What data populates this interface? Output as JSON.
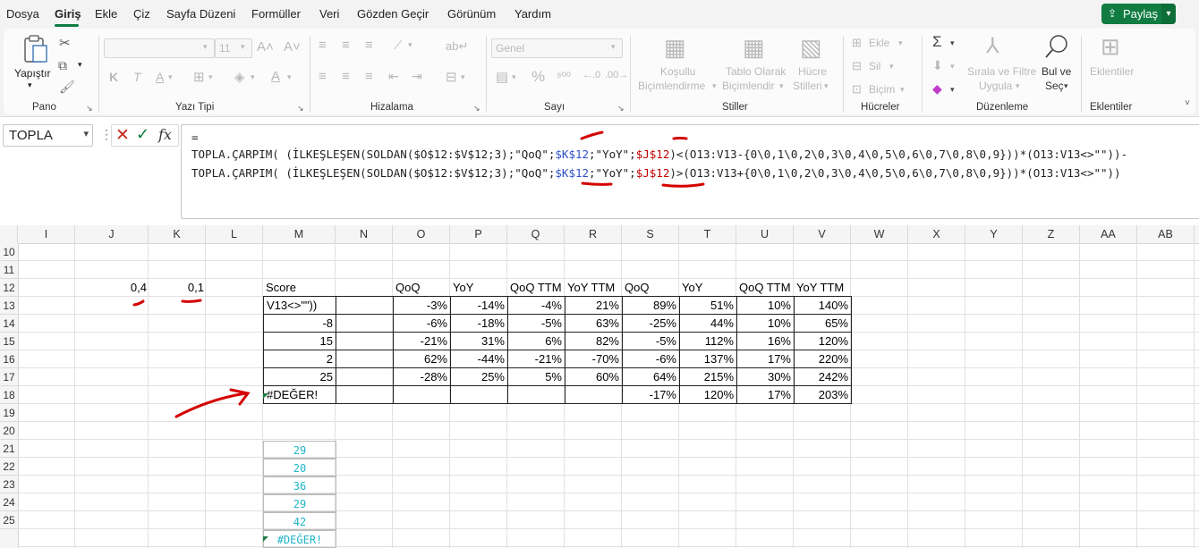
{
  "menu": {
    "items": [
      "Dosya",
      "Giriş",
      "Ekle",
      "Çiz",
      "Sayfa Düzeni",
      "Formüller",
      "Veri",
      "Gözden Geçir",
      "Görünüm",
      "Yardım"
    ],
    "active": "Giriş",
    "share_label": "Paylaş"
  },
  "ribbon": {
    "paste_label": "Yapıştır",
    "font_name": "",
    "font_size": "11",
    "number_format": "Genel",
    "conditional_label_1": "Koşullu",
    "conditional_label_2": "Biçimlendirme",
    "table_label_1": "Tablo Olarak",
    "table_label_2": "Biçimlendir",
    "cellstyles_label_1": "Hücre",
    "cellstyles_label_2": "Stilleri",
    "insert_label": "Ekle",
    "delete_label": "Sil",
    "format_label": "Biçim",
    "sort_label_1": "Sırala ve Filtre",
    "sort_label_2": "Uygula",
    "find_label_1": "Bul ve",
    "find_label_2": "Seç",
    "addins_label": "Eklentiler",
    "groups": {
      "clipboard": "Pano",
      "font": "Yazı Tipi",
      "alignment": "Hizalama",
      "number": "Sayı",
      "styles": "Stiller",
      "cells": "Hücreler",
      "editing": "Düzenleme",
      "addins": "Eklentiler"
    }
  },
  "formula_bar": {
    "name_box": "TOPLA",
    "fx_label": "fx",
    "line1": "=",
    "line2_a": "TOPLA.ÇARPIM( (İLKEŞLEŞEN(SOLDAN($O$12:$V$12;3);\"QoQ\";",
    "line2_b": "$K$12",
    "line2_c": ";\"YoY\";",
    "line2_d": "$J$12",
    "line2_e": ")<(O13:V13-{0\\0,1\\0,2\\0,3\\0,4\\0,5\\0,6\\0,7\\0,8\\0,9}))*(O13:V13<>\"\"))-",
    "line3_a": "TOPLA.ÇARPIM( (İLKEŞLEŞEN(SOLDAN($O$12:$V$12;3);\"QoQ\";",
    "line3_b": "$K$12",
    "line3_c": ";\"YoY\";",
    "line3_d": "$J$12",
    "line3_e": ")>(O13:V13+{0\\0,1\\0,2\\0,3\\0,4\\0,5\\0,6\\0,7\\0,8\\0,9}))*(O13:V13<>\"\"))"
  },
  "columns": [
    "I",
    "J",
    "K",
    "L",
    "M",
    "N",
    "O",
    "P",
    "Q",
    "R",
    "S",
    "T",
    "U",
    "V",
    "W",
    "X",
    "Y",
    "Z",
    "AA",
    "AB"
  ],
  "rows": [
    "10",
    "11",
    "12",
    "13",
    "14",
    "15",
    "16",
    "17",
    "18",
    "19",
    "20",
    "21",
    "22",
    "23",
    "24",
    "25"
  ],
  "sheet": {
    "j12": "0,4",
    "k12": "0,1",
    "m12": "Score",
    "headers": [
      "QoQ",
      "YoY",
      "QoQ TTM",
      "YoY TTM",
      "QoQ",
      "YoY",
      "QoQ TTM",
      "YoY TTM"
    ],
    "m_values": [
      "V13<>\"\"))",
      "-8",
      "15",
      "2",
      "25",
      "#DEĞER!"
    ],
    "table": [
      [
        "-3%",
        "-14%",
        "-4%",
        "21%",
        "89%",
        "51%",
        "10%",
        "140%"
      ],
      [
        "-6%",
        "-18%",
        "-5%",
        "63%",
        "-25%",
        "44%",
        "10%",
        "65%"
      ],
      [
        "-21%",
        "31%",
        "6%",
        "82%",
        "-5%",
        "112%",
        "16%",
        "120%"
      ],
      [
        "62%",
        "-44%",
        "-21%",
        "-70%",
        "-6%",
        "137%",
        "17%",
        "220%"
      ],
      [
        "-28%",
        "25%",
        "5%",
        "60%",
        "64%",
        "215%",
        "30%",
        "242%"
      ],
      [
        "",
        "",
        "",
        "",
        "-17%",
        "120%",
        "17%",
        "203%"
      ]
    ],
    "lower_values": [
      "29",
      "20",
      "36",
      "29",
      "42",
      "#DEĞER!"
    ]
  },
  "colors": {
    "accent": "#107c41",
    "annotation_red": "#d00000",
    "cyan_text": "#21b5c9"
  }
}
